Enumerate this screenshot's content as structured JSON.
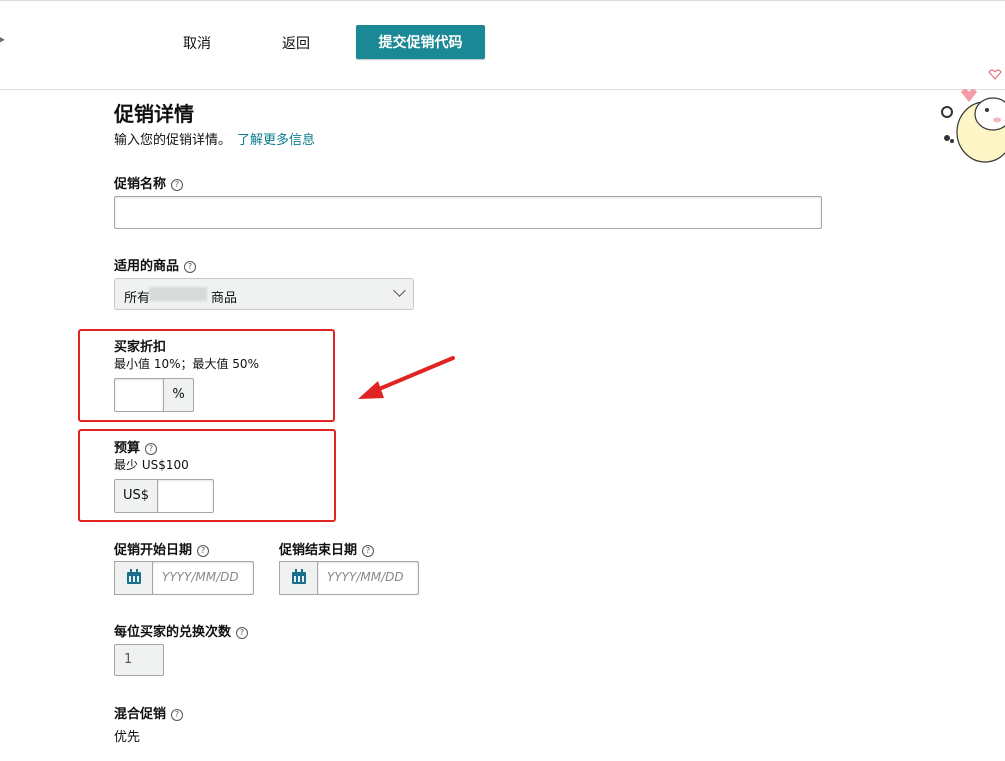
{
  "header": {
    "cancel_label": "取消",
    "back_label": "返回",
    "submit_label": "提交促销代码"
  },
  "section": {
    "title": "促销详情",
    "subtitle": "输入您的促销详情。",
    "learn_more": "了解更多信息"
  },
  "fields": {
    "promo_name": {
      "label": "促销名称",
      "value": ""
    },
    "applicable_products": {
      "label": "适用的商品",
      "selected_prefix": "所有",
      "selected_suffix": "商品"
    },
    "buyer_discount": {
      "label": "买家折扣",
      "hint": "最小值 10%；最大值 50%",
      "unit": "%",
      "value": ""
    },
    "budget": {
      "label": "预算",
      "hint": "最少 US$100",
      "currency": "US$",
      "value": ""
    },
    "start_date": {
      "label": "促销开始日期",
      "placeholder": "YYYY/MM/DD"
    },
    "end_date": {
      "label": "促销结束日期",
      "placeholder": "YYYY/MM/DD"
    },
    "redemptions_per_buyer": {
      "label": "每位买家的兑换次数",
      "value": "1"
    },
    "combined_promo": {
      "label": "混合促销",
      "value": "优先"
    }
  },
  "colors": {
    "primary": "#1a8895",
    "link": "#0a7c8c",
    "annotation_red": "#e02424"
  }
}
